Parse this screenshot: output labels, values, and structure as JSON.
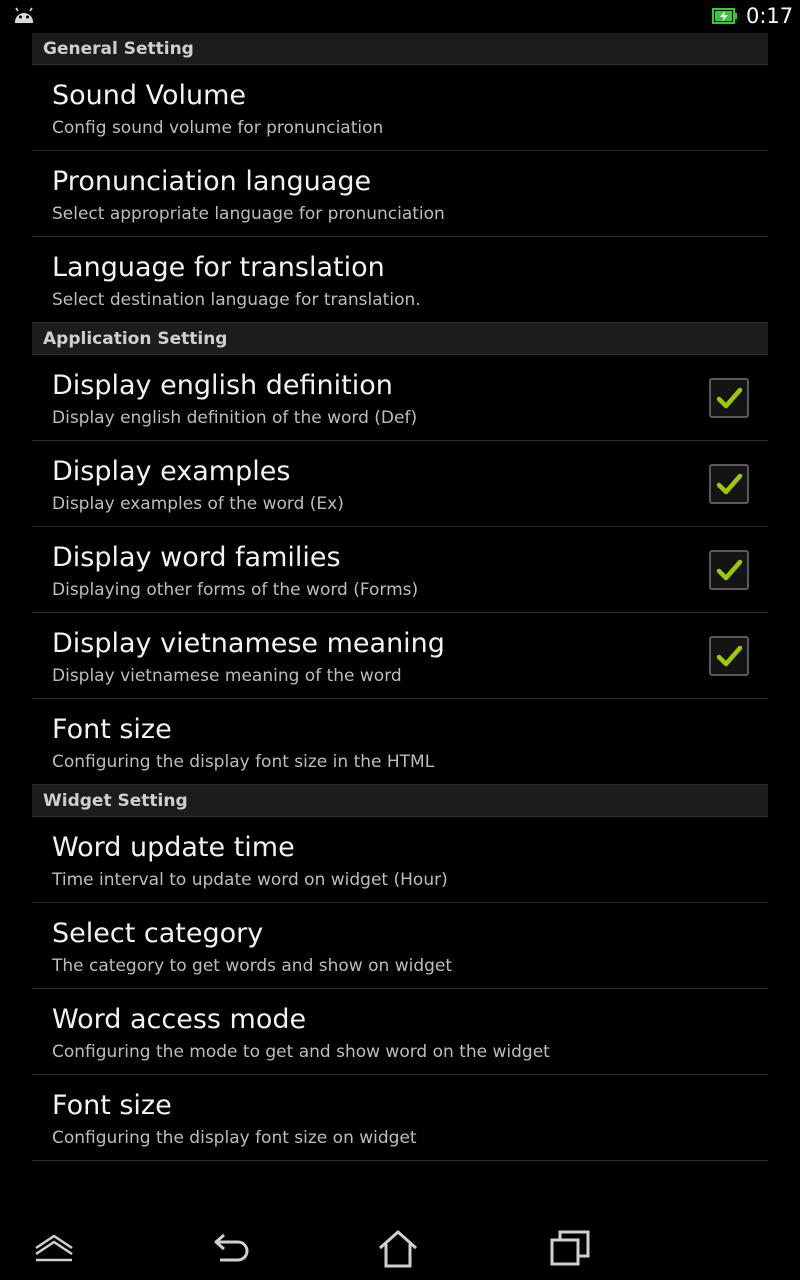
{
  "status_bar": {
    "time": "0:17",
    "icons": [
      "android-icon",
      "battery-charging-icon"
    ]
  },
  "sections": [
    {
      "header": "General Setting",
      "items": [
        {
          "title": "Sound Volume",
          "summary": "Config sound volume for pronunciation"
        },
        {
          "title": "Pronunciation language",
          "summary": "Select appropriate language for pronunciation"
        },
        {
          "title": "Language for translation",
          "summary": "Select destination language for translation."
        }
      ]
    },
    {
      "header": "Application Setting",
      "items": [
        {
          "title": "Display english definition",
          "summary": "Display english definition of the word (Def)",
          "checked": true
        },
        {
          "title": "Display examples",
          "summary": "Display examples of the word (Ex)",
          "checked": true
        },
        {
          "title": "Display word families",
          "summary": "Displaying other forms of the word (Forms)",
          "checked": true
        },
        {
          "title": "Display vietnamese meaning",
          "summary": "Display vietnamese meaning of the word",
          "checked": true
        },
        {
          "title": "Font size",
          "summary": "Configuring the display font size in the HTML"
        }
      ]
    },
    {
      "header": "Widget Setting",
      "items": [
        {
          "title": "Word update time",
          "summary": "Time interval to update word on widget (Hour)"
        },
        {
          "title": "Select category",
          "summary": "The category to get words and show on widget"
        },
        {
          "title": "Word access mode",
          "summary": "Configuring the mode to get and show word on the widget"
        },
        {
          "title": "Font size",
          "summary": "Configuring the display font size on widget"
        }
      ]
    }
  ],
  "nav_bar": {
    "buttons": [
      "up-icon",
      "back-icon",
      "home-icon",
      "recent-apps-icon"
    ]
  },
  "colors": {
    "background": "#000000",
    "section_header_bg": "#1c1c1c",
    "checkmark": "#99cc00",
    "battery": "#33cc33"
  }
}
